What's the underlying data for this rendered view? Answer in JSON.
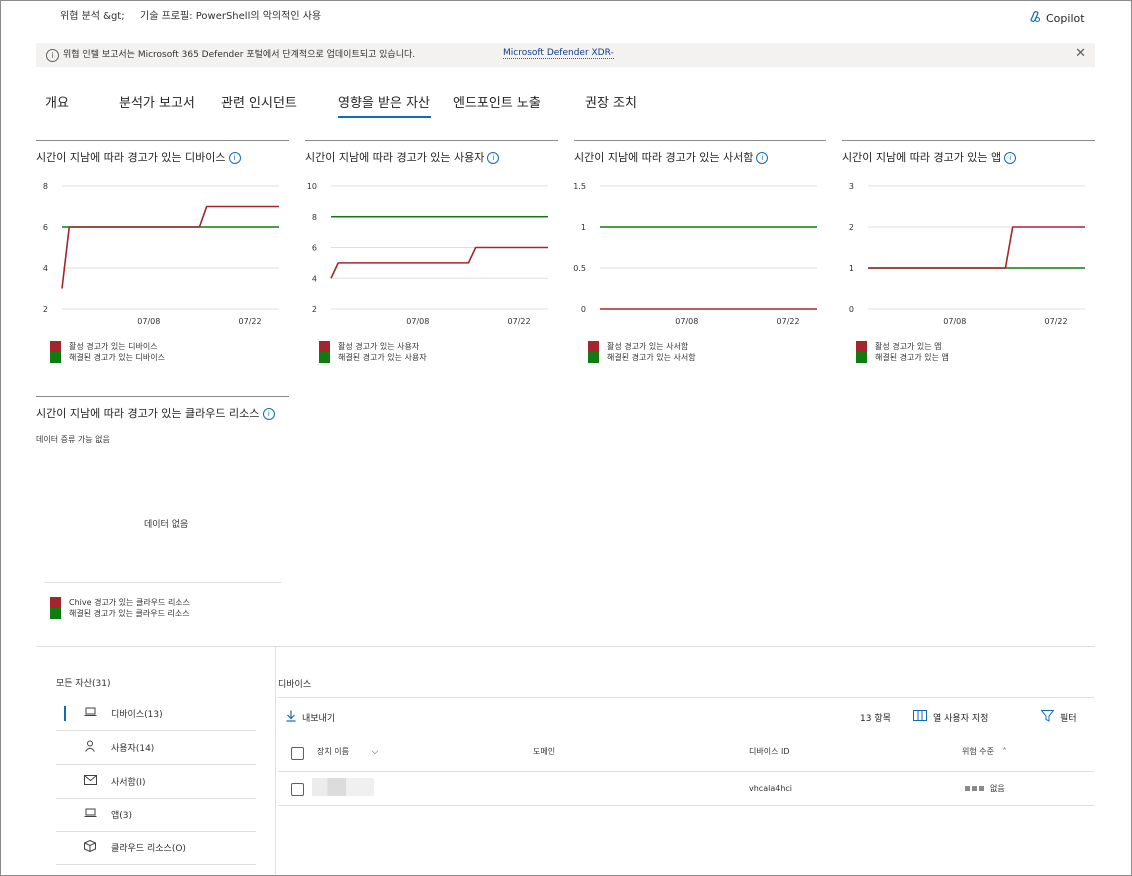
{
  "header": {
    "breadcrumb_1": "위협 분석 &gt;",
    "breadcrumb_2": "기술 프로필: PowerShell의 악의적인 사용",
    "copilot_label": "Copilot"
  },
  "banner": {
    "text": "위협 인텔 보고서는 Microsoft 365 Defender 포털에서 단계적으로 업데이트되고 있습니다.",
    "link": "Microsoft Defender XDR-"
  },
  "tabs": [
    {
      "label": "개요"
    },
    {
      "label": "분석가 보고서"
    },
    {
      "label": "관련 인시던트"
    },
    {
      "label": "영향을 받은 자산"
    },
    {
      "label": "엔드포인트 노출"
    },
    {
      "label": "권장 조치"
    }
  ],
  "colors": {
    "active": "#a4262c",
    "resolved": "#107c10",
    "accent": "#0f6cbd"
  },
  "chart_data": [
    {
      "type": "line",
      "title": "시간이 지남에 따라 경고가 있는 디바이스",
      "x_ticks": [
        "07/08",
        "07/22"
      ],
      "ylim": [
        2,
        8
      ],
      "y_ticks": [
        "8",
        "6",
        "4",
        "2"
      ],
      "grid": true,
      "legend_position": "bottom-left",
      "series": [
        {
          "name": "활성 경고가 있는 디바이스",
          "color": "#a4262c",
          "values": [
            3,
            6,
            6,
            6,
            6,
            6,
            6,
            6,
            6,
            6,
            6,
            6,
            6,
            6,
            6,
            6,
            6,
            6,
            6,
            6,
            7,
            7,
            7,
            7,
            7,
            7,
            7,
            7,
            7,
            7,
            7
          ]
        },
        {
          "name": "해결된 경고가 있는 디바이스",
          "color": "#107c10",
          "values": [
            6,
            6,
            6,
            6,
            6,
            6,
            6,
            6,
            6,
            6,
            6,
            6,
            6,
            6,
            6,
            6,
            6,
            6,
            6,
            6,
            6,
            6,
            6,
            6,
            6,
            6,
            6,
            6,
            6,
            6,
            6
          ]
        }
      ]
    },
    {
      "type": "line",
      "title": "시간이 지남에 따라 경고가 있는 사용자",
      "x_ticks": [
        "07/08",
        "07/22"
      ],
      "ylim": [
        2,
        10
      ],
      "y_ticks": [
        "10",
        "8",
        "6",
        "4",
        "2"
      ],
      "grid": true,
      "legend_position": "bottom-left",
      "series": [
        {
          "name": "활성 경고가 있는 사용자",
          "color": "#a4262c",
          "values": [
            4,
            5,
            5,
            5,
            5,
            5,
            5,
            5,
            5,
            5,
            5,
            5,
            5,
            5,
            5,
            5,
            5,
            5,
            5,
            5,
            6,
            6,
            6,
            6,
            6,
            6,
            6,
            6,
            6,
            6,
            6
          ]
        },
        {
          "name": "해결된 경고가 있는 사용자",
          "color": "#107c10",
          "values": [
            8,
            8,
            8,
            8,
            8,
            8,
            8,
            8,
            8,
            8,
            8,
            8,
            8,
            8,
            8,
            8,
            8,
            8,
            8,
            8,
            8,
            8,
            8,
            8,
            8,
            8,
            8,
            8,
            8,
            8,
            8
          ]
        }
      ]
    },
    {
      "type": "line",
      "title": "시간이 지남에 따라 경고가 있는 사서함",
      "x_ticks": [
        "07/08",
        "07/22"
      ],
      "ylim": [
        0,
        1.5
      ],
      "y_ticks": [
        "1.5",
        "1",
        "0.5",
        "0"
      ],
      "grid": true,
      "legend_position": "bottom-left",
      "series": [
        {
          "name": "활성 경고가 있는 사서함",
          "color": "#a4262c",
          "values": [
            0,
            0,
            0,
            0,
            0,
            0,
            0,
            0,
            0,
            0,
            0,
            0,
            0,
            0,
            0,
            0,
            0,
            0,
            0,
            0,
            0,
            0,
            0,
            0,
            0,
            0,
            0,
            0,
            0,
            0,
            0
          ]
        },
        {
          "name": "해결된 경고가 있는 사서함",
          "color": "#107c10",
          "values": [
            1,
            1,
            1,
            1,
            1,
            1,
            1,
            1,
            1,
            1,
            1,
            1,
            1,
            1,
            1,
            1,
            1,
            1,
            1,
            1,
            1,
            1,
            1,
            1,
            1,
            1,
            1,
            1,
            1,
            1,
            1
          ]
        }
      ]
    },
    {
      "type": "line",
      "title": "시간이 지남에 따라 경고가 있는 앱",
      "x_ticks": [
        "07/08",
        "07/22"
      ],
      "ylim": [
        0,
        3
      ],
      "y_ticks": [
        "3",
        "2",
        "1",
        "0"
      ],
      "grid": true,
      "legend_position": "bottom-left",
      "series": [
        {
          "name": "활성 경고가 있는 앱",
          "color": "#a4262c",
          "values": [
            1,
            1,
            1,
            1,
            1,
            1,
            1,
            1,
            1,
            1,
            1,
            1,
            1,
            1,
            1,
            1,
            1,
            1,
            1,
            1,
            2,
            2,
            2,
            2,
            2,
            2,
            2,
            2,
            2,
            2,
            2
          ]
        },
        {
          "name": "해결된 경고가 있는 앱",
          "color": "#107c10",
          "values": [
            1,
            1,
            1,
            1,
            1,
            1,
            1,
            1,
            1,
            1,
            1,
            1,
            1,
            1,
            1,
            1,
            1,
            1,
            1,
            1,
            1,
            1,
            1,
            1,
            1,
            1,
            1,
            1,
            1,
            1,
            1
          ]
        }
      ]
    }
  ],
  "cloud_chart": {
    "title": "시간이 지남에 따라 경고가 있는 클라우드 리소스",
    "status": "데이터 증류 가능 없음",
    "empty_text": "데이터 없음",
    "legend": [
      "Chive 경고가 있는 클라우드 리소스",
      "해결된 경고가 있는 클라우드 리소스"
    ]
  },
  "left_nav": {
    "title": "모든 자산(31)",
    "items": [
      {
        "label": "디바이스(13)",
        "icon": "laptop-icon"
      },
      {
        "label": "사용자(14)",
        "icon": "person-icon"
      },
      {
        "label": "사서함(I)",
        "icon": "mail-icon"
      },
      {
        "label": "앱(3)",
        "icon": "laptop-icon"
      },
      {
        "label": "클라우드 리소스(O)",
        "icon": "cube-icon"
      }
    ]
  },
  "devices_panel": {
    "title": "디바이스",
    "export_label": "내보내기",
    "count_label": "13 항목",
    "customize_label": "열 사용자 지정",
    "filter_label": "필터",
    "columns": [
      "장치 이름",
      "도메인",
      "디바이스 ID",
      "위험 수준"
    ],
    "rows": [
      {
        "name": "",
        "domain": "",
        "device_id": "vhcala4hci",
        "risk": "없음"
      }
    ]
  }
}
